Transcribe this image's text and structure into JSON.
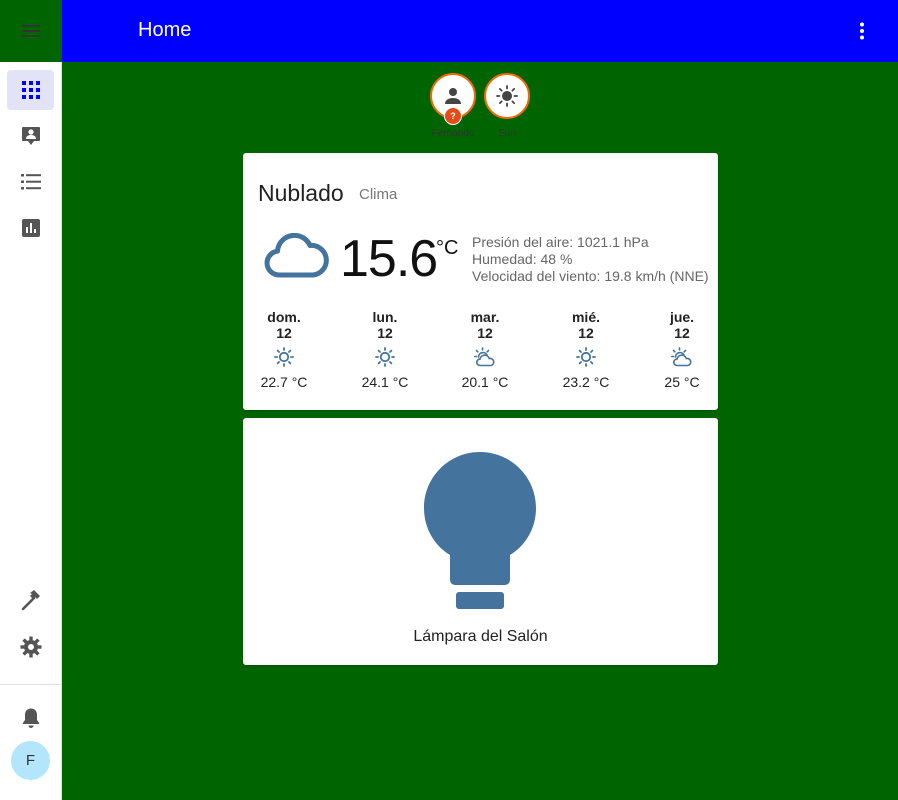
{
  "header": {
    "title": "Home"
  },
  "sidebar": {
    "items": [
      {
        "name": "overview",
        "icon": "grid-icon"
      },
      {
        "name": "logbook",
        "icon": "account-box-icon"
      },
      {
        "name": "todo",
        "icon": "list-icon"
      },
      {
        "name": "history",
        "icon": "chart-icon"
      },
      {
        "name": "developer",
        "icon": "hammer-icon"
      },
      {
        "name": "settings",
        "icon": "gear-icon"
      },
      {
        "name": "notifications",
        "icon": "bell-icon"
      }
    ],
    "user_initial": "F"
  },
  "badges": [
    {
      "label": "Fernando",
      "icon": "person-icon",
      "status": "?"
    },
    {
      "label": "Sun",
      "icon": "sun-icon"
    }
  ],
  "weather": {
    "state": "Nublado",
    "source": "Clima",
    "temperature": "15.6",
    "unit": "°C",
    "pressure": "Presión del aire: 1021.1 hPa",
    "humidity": "Humedad: 48 %",
    "wind": "Velocidad del viento: 19.8 km/h (NNE)",
    "forecast": [
      {
        "day": "dom.",
        "date": "12",
        "icon": "sunny-icon",
        "temp": "22.7 °C"
      },
      {
        "day": "lun.",
        "date": "12",
        "icon": "sunny-icon",
        "temp": "24.1 °C"
      },
      {
        "day": "mar.",
        "date": "12",
        "icon": "partly-cloudy-icon",
        "temp": "20.1 °C"
      },
      {
        "day": "mié.",
        "date": "12",
        "icon": "sunny-icon",
        "temp": "23.2 °C"
      },
      {
        "day": "jue.",
        "date": "12",
        "icon": "partly-cloudy-icon",
        "temp": "25 °C"
      }
    ]
  },
  "light": {
    "name": "Lámpara del Salón"
  },
  "colors": {
    "header": "#0000ff",
    "background": "#006400",
    "icon_blue": "#44739e",
    "badge_border": "#ef6c00",
    "active_nav": "#0000ff"
  }
}
